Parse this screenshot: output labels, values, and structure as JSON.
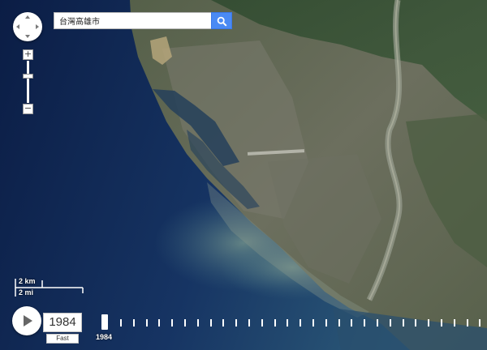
{
  "search": {
    "query": "台灣高雄市"
  },
  "icons": {
    "search": "search-icon",
    "play": "play-icon",
    "pan": "pan-arrows-icon"
  },
  "colors": {
    "search_button": "#4a8af4",
    "control_bg": "#ffffff"
  },
  "zoom": {
    "in_label": "+",
    "out_label": "−"
  },
  "scale": {
    "km_label": "2 km",
    "mi_label": "2 mi"
  },
  "player": {
    "year": "1984",
    "speed_label": "Fast"
  },
  "timeline": {
    "current_year_label": "1984",
    "tick_count": 29
  }
}
